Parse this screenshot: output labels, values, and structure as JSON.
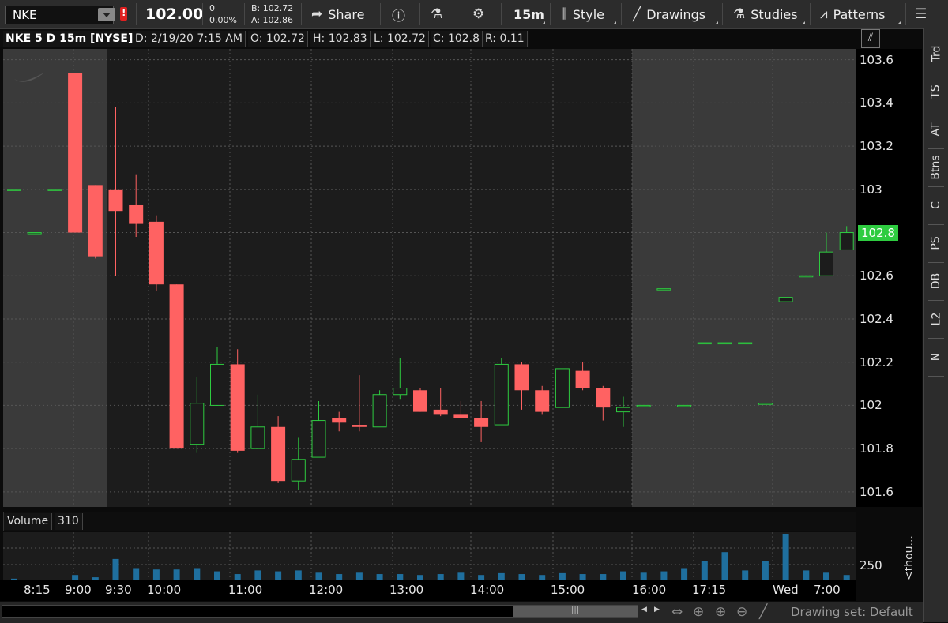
{
  "toolbar": {
    "symbol": "NKE",
    "last": "102.00",
    "change": "0",
    "change_pct": "0.00%",
    "bid": "B: 102.72",
    "ask": "A: 102.86",
    "share": "Share",
    "interval": "15m",
    "style": "Style",
    "drawings": "Drawings",
    "studies": "Studies",
    "patterns": "Patterns"
  },
  "info": {
    "title": "NKE 5 D 15m [NYSE]",
    "date": "D: 2/19/20 7:15 AM",
    "open": "O: 102.72",
    "high": "H: 102.83",
    "low": "L: 102.72",
    "close": "C: 102.8",
    "range": "R: 0.11"
  },
  "side_tabs": [
    "Trd",
    "TS",
    "AT",
    "Btns",
    "C",
    "PS",
    "DB",
    "L2",
    "N"
  ],
  "price_axis": {
    "ticks": [
      "103.6",
      "103.4",
      "103.2",
      "103",
      "102.8",
      "102.6",
      "102.4",
      "102.2",
      "102",
      "101.8",
      "101.6"
    ],
    "last_label": "102.8"
  },
  "volume": {
    "label": "Volume",
    "value": "310",
    "axis_label": "250",
    "unit_label": "<thou..."
  },
  "time_axis": [
    "8:15",
    "9:00",
    "9:30",
    "10:00",
    "11:00",
    "12:00",
    "13:00",
    "14:00",
    "15:00",
    "16:00",
    "17:15",
    "Wed",
    "7:00"
  ],
  "bottom": {
    "drawing_set": "Drawing set: Default"
  },
  "colors": {
    "up": "#2ecc40",
    "down": "#ff6262",
    "volume": "#1f6f9e",
    "last_tag": "#2ecc40"
  },
  "chart_data": {
    "type": "candlestick",
    "ylim": [
      101.53,
      103.65
    ],
    "candles": [
      {
        "o": 103.0,
        "h": 103.0,
        "l": 103.0,
        "c": 103.0
      },
      {
        "o": 102.8,
        "h": 102.8,
        "l": 102.8,
        "c": 102.8
      },
      {
        "o": 103.0,
        "h": 103.0,
        "l": 103.0,
        "c": 103.0
      },
      {
        "o": 103.54,
        "h": 103.54,
        "l": 102.8,
        "c": 102.8
      },
      {
        "o": 103.02,
        "h": 103.02,
        "l": 102.68,
        "c": 102.69
      },
      {
        "o": 103.0,
        "h": 103.38,
        "l": 102.6,
        "c": 102.9
      },
      {
        "o": 102.93,
        "h": 103.07,
        "l": 102.78,
        "c": 102.84
      },
      {
        "o": 102.85,
        "h": 102.88,
        "l": 102.53,
        "c": 102.56
      },
      {
        "o": 102.56,
        "h": 102.56,
        "l": 101.8,
        "c": 101.8
      },
      {
        "o": 101.82,
        "h": 102.13,
        "l": 101.78,
        "c": 102.01
      },
      {
        "o": 102.0,
        "h": 102.27,
        "l": 102.0,
        "c": 102.19
      },
      {
        "o": 102.19,
        "h": 102.26,
        "l": 101.78,
        "c": 101.79
      },
      {
        "o": 101.8,
        "h": 102.05,
        "l": 101.8,
        "c": 101.9
      },
      {
        "o": 101.9,
        "h": 101.95,
        "l": 101.64,
        "c": 101.65
      },
      {
        "o": 101.65,
        "h": 101.85,
        "l": 101.61,
        "c": 101.75
      },
      {
        "o": 101.76,
        "h": 102.02,
        "l": 101.76,
        "c": 101.93
      },
      {
        "o": 101.94,
        "h": 101.97,
        "l": 101.88,
        "c": 101.92
      },
      {
        "o": 101.91,
        "h": 102.14,
        "l": 101.88,
        "c": 101.9
      },
      {
        "o": 101.9,
        "h": 102.07,
        "l": 101.9,
        "c": 102.05
      },
      {
        "o": 102.05,
        "h": 102.22,
        "l": 102.03,
        "c": 102.08
      },
      {
        "o": 102.07,
        "h": 102.08,
        "l": 101.97,
        "c": 101.97
      },
      {
        "o": 101.98,
        "h": 102.08,
        "l": 101.95,
        "c": 101.96
      },
      {
        "o": 101.96,
        "h": 102.02,
        "l": 101.94,
        "c": 101.94
      },
      {
        "o": 101.94,
        "h": 102.02,
        "l": 101.83,
        "c": 101.9
      },
      {
        "o": 101.91,
        "h": 102.22,
        "l": 101.91,
        "c": 102.19
      },
      {
        "o": 102.19,
        "h": 102.2,
        "l": 101.98,
        "c": 102.07
      },
      {
        "o": 102.07,
        "h": 102.09,
        "l": 101.96,
        "c": 101.97
      },
      {
        "o": 101.99,
        "h": 102.17,
        "l": 101.99,
        "c": 102.17
      },
      {
        "o": 102.16,
        "h": 102.2,
        "l": 102.07,
        "c": 102.08
      },
      {
        "o": 102.08,
        "h": 102.09,
        "l": 101.93,
        "c": 101.99
      },
      {
        "o": 101.97,
        "h": 102.04,
        "l": 101.9,
        "c": 101.99
      },
      {
        "o": 102.0,
        "h": 102.0,
        "l": 102.0,
        "c": 102.0
      },
      {
        "o": 102.54,
        "h": 102.54,
        "l": 102.54,
        "c": 102.54
      },
      {
        "o": 102.0,
        "h": 102.0,
        "l": 102.0,
        "c": 102.0
      },
      {
        "o": 102.29,
        "h": 102.29,
        "l": 102.29,
        "c": 102.29
      },
      {
        "o": 102.29,
        "h": 102.29,
        "l": 102.29,
        "c": 102.29
      },
      {
        "o": 102.29,
        "h": 102.29,
        "l": 102.29,
        "c": 102.29
      },
      {
        "o": 102.01,
        "h": 102.01,
        "l": 102.01,
        "c": 102.01
      },
      {
        "o": 102.48,
        "h": 102.5,
        "l": 102.48,
        "c": 102.5
      },
      {
        "o": 102.6,
        "h": 102.6,
        "l": 102.6,
        "c": 102.6
      },
      {
        "o": 102.6,
        "h": 102.8,
        "l": 102.6,
        "c": 102.71
      },
      {
        "o": 102.72,
        "h": 102.83,
        "l": 102.72,
        "c": 102.8
      }
    ],
    "volume": [
      2,
      0,
      0,
      10,
      5,
      45,
      25,
      22,
      22,
      25,
      18,
      12,
      20,
      18,
      20,
      15,
      12,
      15,
      12,
      12,
      10,
      12,
      15,
      10,
      14,
      12,
      10,
      14,
      12,
      12,
      18,
      15,
      18,
      25,
      40,
      60,
      20,
      40,
      100,
      20,
      15,
      10
    ]
  }
}
